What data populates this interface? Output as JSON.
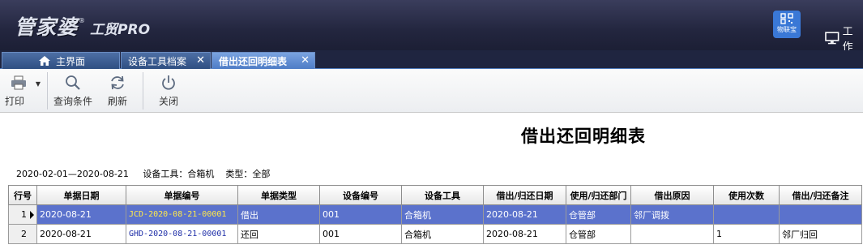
{
  "app": {
    "logo_text": "管家婆",
    "logo_reg": "®",
    "logo_sub": "工贸PRO",
    "lianbao_label": "物联宝",
    "workarea_label": "工作"
  },
  "tabs": [
    {
      "label": "主界面",
      "icon": "home-icon"
    },
    {
      "label": "设备工具档案",
      "icon": "close-icon"
    },
    {
      "label": "借出还回明细表",
      "icon": "close-icon"
    }
  ],
  "toolbar": {
    "print": "打印",
    "query": "查询条件",
    "refresh": "刷新",
    "close": "关闭"
  },
  "report": {
    "title": "借出还回明细表",
    "date_range": "2020-02-01—2020-08-21",
    "tool_label": "设备工具",
    "tool_value": "合箱机",
    "type_label": "类型",
    "type_value": "全部",
    "colon": "："
  },
  "table": {
    "columns": [
      "行号",
      "单据日期",
      "单据编号",
      "单据类型",
      "设备编号",
      "设备工具",
      "借出/归还日期",
      "使用/归还部门",
      "借出原因",
      "使用次数",
      "借出/归还备注"
    ],
    "rows": [
      [
        "1",
        "2020-08-21",
        "JCD-2020-08-21-00001",
        "借出",
        "001",
        "合箱机",
        "2020-08-21",
        "仓管部",
        "邻厂调拨",
        "",
        ""
      ],
      [
        "2",
        "2020-08-21",
        "GHD-2020-08-21-00001",
        "还回",
        "001",
        "合箱机",
        "2020-08-21",
        "仓管部",
        "",
        "1",
        "邻厂归回"
      ]
    ],
    "selected_row": 0
  },
  "colors": {
    "header_bg": "#23263f",
    "selected_row": "#5b72cc",
    "tab_active": "#5e8bd4"
  }
}
